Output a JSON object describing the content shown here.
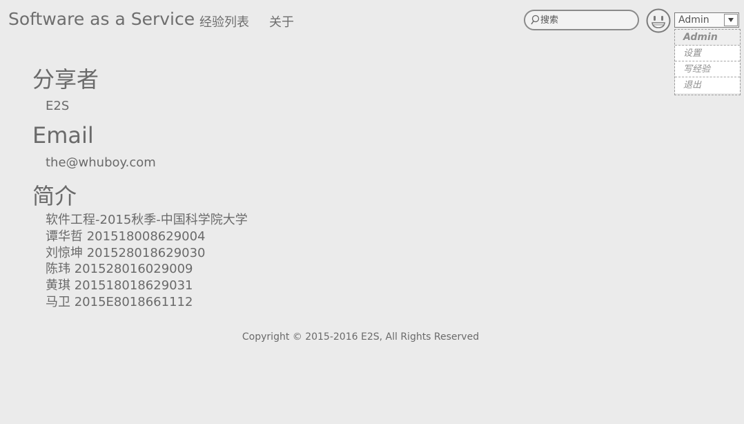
{
  "header": {
    "brand": "Software as a Service",
    "nav": [
      {
        "label": "经验列表"
      },
      {
        "label": "关于"
      }
    ],
    "search": {
      "placeholder": "搜索",
      "value": ""
    },
    "avatar_icon": "smiley-face-icon",
    "user_select": {
      "value": "Admin"
    },
    "dropdown": {
      "items": [
        "Admin",
        "设置",
        "写经验",
        "退出"
      ]
    }
  },
  "profile": {
    "sharer_heading": "分享者",
    "sharer_value": "E2S",
    "email_heading": "Email",
    "email_value": "the@whuboy.com",
    "intro_heading": "简介",
    "intro_lines": [
      "软件工程-2015秋季-中国科学院大学",
      "谭华哲 201518008629004",
      "刘惊坤 201528018629030",
      "陈玮 201528016029009",
      "黄琪 201518018629031",
      "马卫 2015E8018661112"
    ]
  },
  "footer": {
    "copyright": "Copyright © 2015-2016 E2S, All Rights Reserved"
  },
  "colors": {
    "background": "#ebebeb",
    "text": "#6a6a6a",
    "border": "#8a8a8a"
  }
}
